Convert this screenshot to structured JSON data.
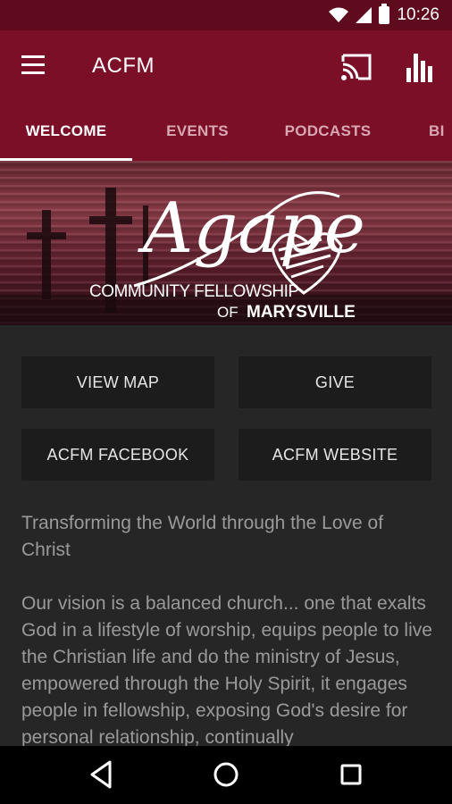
{
  "status_bar": {
    "time": "10:26"
  },
  "app_bar": {
    "title": "ACFM"
  },
  "tabs": [
    {
      "label": "WELCOME",
      "active": true
    },
    {
      "label": "EVENTS",
      "active": false
    },
    {
      "label": "PODCASTS",
      "active": false
    },
    {
      "label": "BI",
      "active": false
    }
  ],
  "hero": {
    "logo_main": "Agape",
    "logo_line1": "COMMUNITY FELLOWSHIP",
    "logo_line2_prefix": "OF",
    "logo_line2_name": "MARYSVILLE"
  },
  "buttons": {
    "view_map": "VIEW MAP",
    "give": "GIVE",
    "facebook": "ACFM FACEBOOK",
    "website": "ACFM WEBSITE"
  },
  "content": {
    "tagline": "Transforming the World through the Love of Christ",
    "vision": "Our vision is a balanced church... one that exalts God in a lifestyle of worship, equips people to live the Christian life and do the ministry of Jesus, empowered through the Holy Spirit, it engages people in fellowship, exposing God's desire for personal relationship, continually"
  },
  "colors": {
    "status_bar": "#5e0b1d",
    "app_bar": "#7a0f27",
    "background": "#262626",
    "button_bg": "#1c1c1c"
  }
}
